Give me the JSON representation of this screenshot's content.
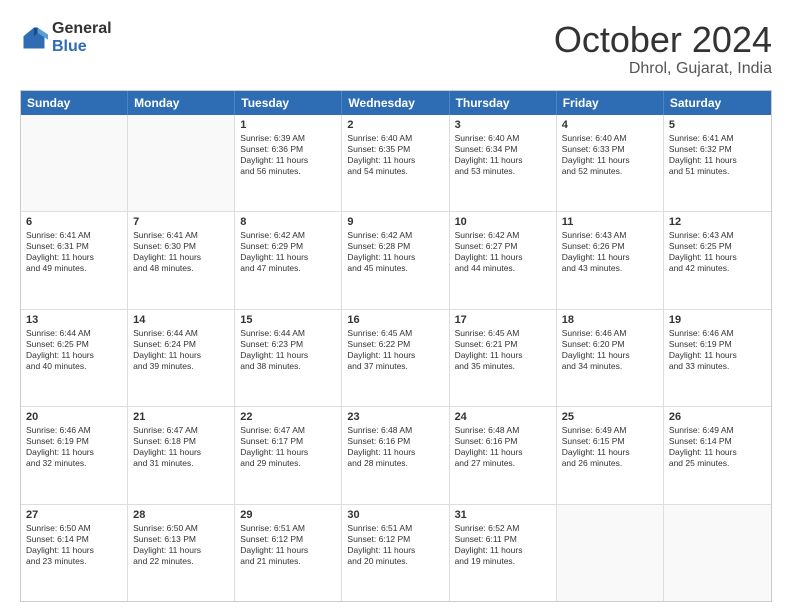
{
  "logo": {
    "line1": "General",
    "line2": "Blue"
  },
  "title": "October 2024",
  "subtitle": "Dhrol, Gujarat, India",
  "headers": [
    "Sunday",
    "Monday",
    "Tuesday",
    "Wednesday",
    "Thursday",
    "Friday",
    "Saturday"
  ],
  "rows": [
    [
      {
        "day": "",
        "lines": [],
        "empty": true
      },
      {
        "day": "",
        "lines": [],
        "empty": true
      },
      {
        "day": "1",
        "lines": [
          "Sunrise: 6:39 AM",
          "Sunset: 6:36 PM",
          "Daylight: 11 hours",
          "and 56 minutes."
        ]
      },
      {
        "day": "2",
        "lines": [
          "Sunrise: 6:40 AM",
          "Sunset: 6:35 PM",
          "Daylight: 11 hours",
          "and 54 minutes."
        ]
      },
      {
        "day": "3",
        "lines": [
          "Sunrise: 6:40 AM",
          "Sunset: 6:34 PM",
          "Daylight: 11 hours",
          "and 53 minutes."
        ]
      },
      {
        "day": "4",
        "lines": [
          "Sunrise: 6:40 AM",
          "Sunset: 6:33 PM",
          "Daylight: 11 hours",
          "and 52 minutes."
        ]
      },
      {
        "day": "5",
        "lines": [
          "Sunrise: 6:41 AM",
          "Sunset: 6:32 PM",
          "Daylight: 11 hours",
          "and 51 minutes."
        ]
      }
    ],
    [
      {
        "day": "6",
        "lines": [
          "Sunrise: 6:41 AM",
          "Sunset: 6:31 PM",
          "Daylight: 11 hours",
          "and 49 minutes."
        ]
      },
      {
        "day": "7",
        "lines": [
          "Sunrise: 6:41 AM",
          "Sunset: 6:30 PM",
          "Daylight: 11 hours",
          "and 48 minutes."
        ]
      },
      {
        "day": "8",
        "lines": [
          "Sunrise: 6:42 AM",
          "Sunset: 6:29 PM",
          "Daylight: 11 hours",
          "and 47 minutes."
        ]
      },
      {
        "day": "9",
        "lines": [
          "Sunrise: 6:42 AM",
          "Sunset: 6:28 PM",
          "Daylight: 11 hours",
          "and 45 minutes."
        ]
      },
      {
        "day": "10",
        "lines": [
          "Sunrise: 6:42 AM",
          "Sunset: 6:27 PM",
          "Daylight: 11 hours",
          "and 44 minutes."
        ]
      },
      {
        "day": "11",
        "lines": [
          "Sunrise: 6:43 AM",
          "Sunset: 6:26 PM",
          "Daylight: 11 hours",
          "and 43 minutes."
        ]
      },
      {
        "day": "12",
        "lines": [
          "Sunrise: 6:43 AM",
          "Sunset: 6:25 PM",
          "Daylight: 11 hours",
          "and 42 minutes."
        ]
      }
    ],
    [
      {
        "day": "13",
        "lines": [
          "Sunrise: 6:44 AM",
          "Sunset: 6:25 PM",
          "Daylight: 11 hours",
          "and 40 minutes."
        ]
      },
      {
        "day": "14",
        "lines": [
          "Sunrise: 6:44 AM",
          "Sunset: 6:24 PM",
          "Daylight: 11 hours",
          "and 39 minutes."
        ]
      },
      {
        "day": "15",
        "lines": [
          "Sunrise: 6:44 AM",
          "Sunset: 6:23 PM",
          "Daylight: 11 hours",
          "and 38 minutes."
        ]
      },
      {
        "day": "16",
        "lines": [
          "Sunrise: 6:45 AM",
          "Sunset: 6:22 PM",
          "Daylight: 11 hours",
          "and 37 minutes."
        ]
      },
      {
        "day": "17",
        "lines": [
          "Sunrise: 6:45 AM",
          "Sunset: 6:21 PM",
          "Daylight: 11 hours",
          "and 35 minutes."
        ]
      },
      {
        "day": "18",
        "lines": [
          "Sunrise: 6:46 AM",
          "Sunset: 6:20 PM",
          "Daylight: 11 hours",
          "and 34 minutes."
        ]
      },
      {
        "day": "19",
        "lines": [
          "Sunrise: 6:46 AM",
          "Sunset: 6:19 PM",
          "Daylight: 11 hours",
          "and 33 minutes."
        ]
      }
    ],
    [
      {
        "day": "20",
        "lines": [
          "Sunrise: 6:46 AM",
          "Sunset: 6:19 PM",
          "Daylight: 11 hours",
          "and 32 minutes."
        ]
      },
      {
        "day": "21",
        "lines": [
          "Sunrise: 6:47 AM",
          "Sunset: 6:18 PM",
          "Daylight: 11 hours",
          "and 31 minutes."
        ]
      },
      {
        "day": "22",
        "lines": [
          "Sunrise: 6:47 AM",
          "Sunset: 6:17 PM",
          "Daylight: 11 hours",
          "and 29 minutes."
        ]
      },
      {
        "day": "23",
        "lines": [
          "Sunrise: 6:48 AM",
          "Sunset: 6:16 PM",
          "Daylight: 11 hours",
          "and 28 minutes."
        ]
      },
      {
        "day": "24",
        "lines": [
          "Sunrise: 6:48 AM",
          "Sunset: 6:16 PM",
          "Daylight: 11 hours",
          "and 27 minutes."
        ]
      },
      {
        "day": "25",
        "lines": [
          "Sunrise: 6:49 AM",
          "Sunset: 6:15 PM",
          "Daylight: 11 hours",
          "and 26 minutes."
        ]
      },
      {
        "day": "26",
        "lines": [
          "Sunrise: 6:49 AM",
          "Sunset: 6:14 PM",
          "Daylight: 11 hours",
          "and 25 minutes."
        ]
      }
    ],
    [
      {
        "day": "27",
        "lines": [
          "Sunrise: 6:50 AM",
          "Sunset: 6:14 PM",
          "Daylight: 11 hours",
          "and 23 minutes."
        ]
      },
      {
        "day": "28",
        "lines": [
          "Sunrise: 6:50 AM",
          "Sunset: 6:13 PM",
          "Daylight: 11 hours",
          "and 22 minutes."
        ]
      },
      {
        "day": "29",
        "lines": [
          "Sunrise: 6:51 AM",
          "Sunset: 6:12 PM",
          "Daylight: 11 hours",
          "and 21 minutes."
        ]
      },
      {
        "day": "30",
        "lines": [
          "Sunrise: 6:51 AM",
          "Sunset: 6:12 PM",
          "Daylight: 11 hours",
          "and 20 minutes."
        ]
      },
      {
        "day": "31",
        "lines": [
          "Sunrise: 6:52 AM",
          "Sunset: 6:11 PM",
          "Daylight: 11 hours",
          "and 19 minutes."
        ]
      },
      {
        "day": "",
        "lines": [],
        "empty": true
      },
      {
        "day": "",
        "lines": [],
        "empty": true
      }
    ]
  ]
}
